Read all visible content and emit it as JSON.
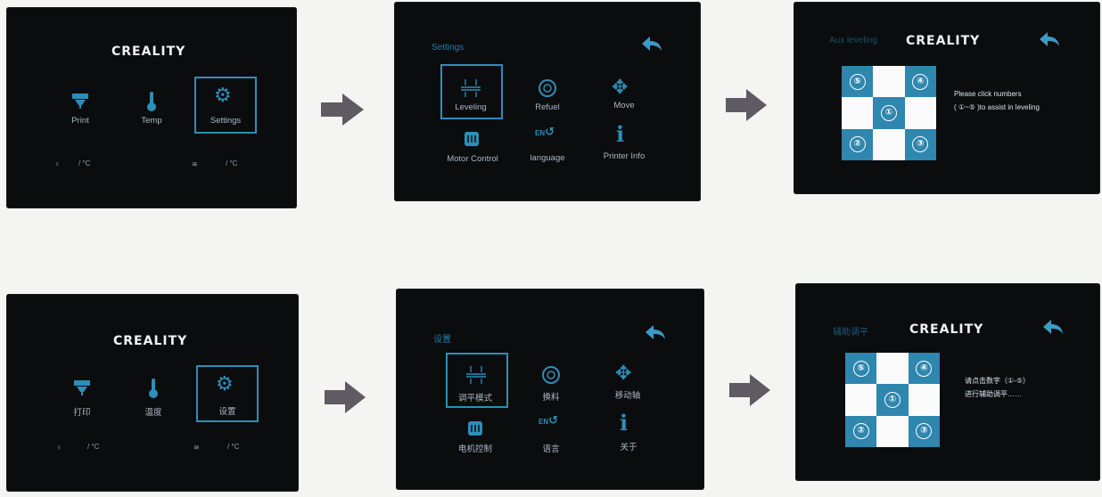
{
  "brand": "CREALITY",
  "en": {
    "home": {
      "print": "Print",
      "temp": "Temp",
      "settings": "Settings",
      "nozzle_status": "/   °C",
      "bed_status": "/   °C"
    },
    "settings": {
      "title": "Settings",
      "leveling": "Leveling",
      "refuel": "Refuel",
      "move": "Move",
      "motor": "Motor Control",
      "language": "language",
      "info": "Printer Info"
    },
    "aux": {
      "title": "Aux leveling",
      "hint1": "Please click numbers",
      "hint2": "( ①~⑤ )to assist in leveling"
    }
  },
  "zh": {
    "home": {
      "print": "打印",
      "temp": "温度",
      "settings": "设置",
      "nozzle_status": "/   °C",
      "bed_status": "/   °C"
    },
    "settings": {
      "title": "设置",
      "leveling": "调平模式",
      "refuel": "换料",
      "move": "移动轴",
      "motor": "电机控制",
      "language": "语言",
      "info": "关于"
    },
    "aux": {
      "title": "辅助调平",
      "hint1": "请点击数字（①-⑤）",
      "hint2": "进行辅助调平……"
    }
  },
  "grid_numbers": [
    "⑤",
    "④",
    "①",
    "②",
    "③"
  ],
  "lang_icon_text": "EN",
  "colors": {
    "accent": "#2c8fb8",
    "screen": "#0b0c0e",
    "arrow": "#5f5b62"
  }
}
